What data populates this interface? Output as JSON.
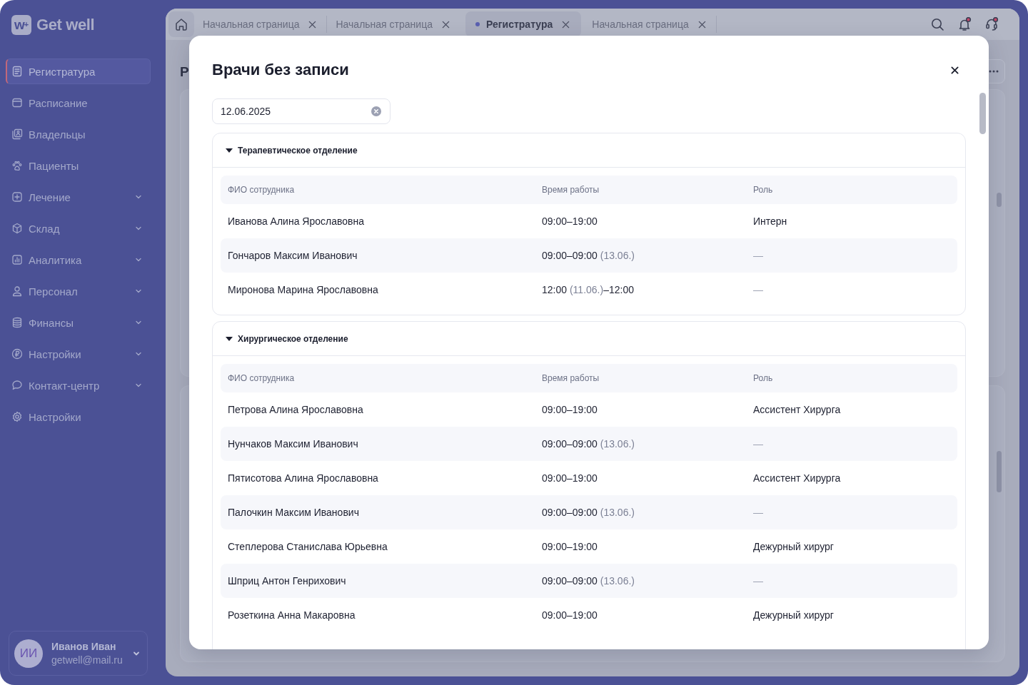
{
  "sidebar": {
    "logo": {
      "mark": "w$^{+}$",
      "name": "Get well"
    },
    "items": [
      {
        "label": "Регистратура",
        "kind": "link",
        "selected": true
      },
      {
        "label": "Расписание",
        "kind": "link",
        "selected": false
      },
      {
        "label": "Владельцы",
        "kind": "link",
        "selected": false
      },
      {
        "label": "Пациенты",
        "kind": "link",
        "selected": false
      },
      {
        "label": "Лечение",
        "kind": "group",
        "expanded": false,
        "selected": false
      },
      {
        "label": "Склад",
        "kind": "group",
        "expanded": false,
        "selected": false
      },
      {
        "label": "Аналитика",
        "kind": "group",
        "expanded": false,
        "selected": false
      },
      {
        "label": "Персонал",
        "kind": "group",
        "expanded": false,
        "selected": false
      },
      {
        "label": "Финансы",
        "kind": "group",
        "expanded": false,
        "selected": false
      },
      {
        "label": "Настройки",
        "kind": "group",
        "expanded": false,
        "selected": false
      },
      {
        "label": "Контакт-центр",
        "kind": "group",
        "expanded": false,
        "selected": false
      },
      {
        "label": "Настройки",
        "kind": "link",
        "selected": false
      }
    ],
    "user": {
      "initials": "ИИ",
      "name": "Иванов Иван",
      "email": "getwell@mail.ru"
    }
  },
  "tabs": [
    {
      "label": "Начальная страница",
      "selected": false
    },
    {
      "label": "Начальная страница",
      "selected": false
    },
    {
      "label": "Регистратура",
      "selected": true
    },
    {
      "label": "Начальная страница",
      "selected": false
    }
  ],
  "toolbar": [
    {
      "kind": "search"
    },
    {
      "kind": "notifications",
      "alert": true
    },
    {
      "kind": "support",
      "alert": true
    }
  ],
  "page": {
    "title": "Р"
  },
  "modal": {
    "title": "Врачи без записи",
    "date_field": {
      "value": "12.06.2025"
    },
    "sections": [
      {
        "title": "Терапевтическое отделение",
        "expanded": true,
        "columns": [
          "ФИО сотрудника",
          "Время работы",
          "Роль"
        ],
        "rows": [
          {
            "name": "Иванова Алина Ярославовна",
            "time": [
              {
                "text": "09:00–19:00",
                "kind": "time"
              }
            ],
            "role": {
              "text": "Интерн",
              "kind": "value"
            }
          },
          {
            "name": "Гончаров Максим Иванович",
            "time": [
              {
                "text": "09:00–09:00 ",
                "kind": "time"
              },
              {
                "text": "(13.06.)",
                "kind": "date"
              }
            ],
            "role": {
              "text": "—",
              "kind": "none"
            }
          },
          {
            "name": "Миронова Марина Ярославовна",
            "time": [
              {
                "text": "12:00 ",
                "kind": "time"
              },
              {
                "text": "(11.06.)",
                "kind": "date"
              },
              {
                "text": "–12:00",
                "kind": "time"
              }
            ],
            "role": {
              "text": "—",
              "kind": "none"
            }
          }
        ]
      },
      {
        "title": "Хирургическое отделение",
        "expanded": true,
        "columns": [
          "ФИО сотрудника",
          "Время работы",
          "Роль"
        ],
        "rows": [
          {
            "name": "Петрова Алина Ярославовна",
            "time": [
              {
                "text": "09:00–19:00",
                "kind": "time"
              }
            ],
            "role": {
              "text": "Ассистент Хирурга",
              "kind": "value"
            }
          },
          {
            "name": "Нунчаков Максим Иванович",
            "time": [
              {
                "text": "09:00–09:00 ",
                "kind": "time"
              },
              {
                "text": "(13.06.)",
                "kind": "date"
              }
            ],
            "role": {
              "text": "—",
              "kind": "none"
            }
          },
          {
            "name": "Пятисотова Алина Ярославовна",
            "time": [
              {
                "text": "09:00–19:00",
                "kind": "time"
              }
            ],
            "role": {
              "text": "Ассистент Хирурга",
              "kind": "value"
            }
          },
          {
            "name": "Палочкин Максим Иванович",
            "time": [
              {
                "text": "09:00–09:00 ",
                "kind": "time"
              },
              {
                "text": "(13.06.)",
                "kind": "date"
              }
            ],
            "role": {
              "text": "—",
              "kind": "none"
            }
          },
          {
            "name": "Степлерова Станислава Юрьевна",
            "time": [
              {
                "text": "09:00–19:00",
                "kind": "time"
              }
            ],
            "role": {
              "text": "Дежурный хирург",
              "kind": "value"
            }
          },
          {
            "name": "Шприц Антон Генрихович",
            "time": [
              {
                "text": "09:00–09:00 ",
                "kind": "time"
              },
              {
                "text": "(13.06.)",
                "kind": "date"
              }
            ],
            "role": {
              "text": "—",
              "kind": "none"
            }
          },
          {
            "name": "Розеткина Анна Макаровна",
            "time": [
              {
                "text": "09:00–19:00",
                "kind": "time"
              }
            ],
            "role": {
              "text": "Дежурный хирург",
              "kind": "value"
            }
          }
        ]
      }
    ]
  }
}
